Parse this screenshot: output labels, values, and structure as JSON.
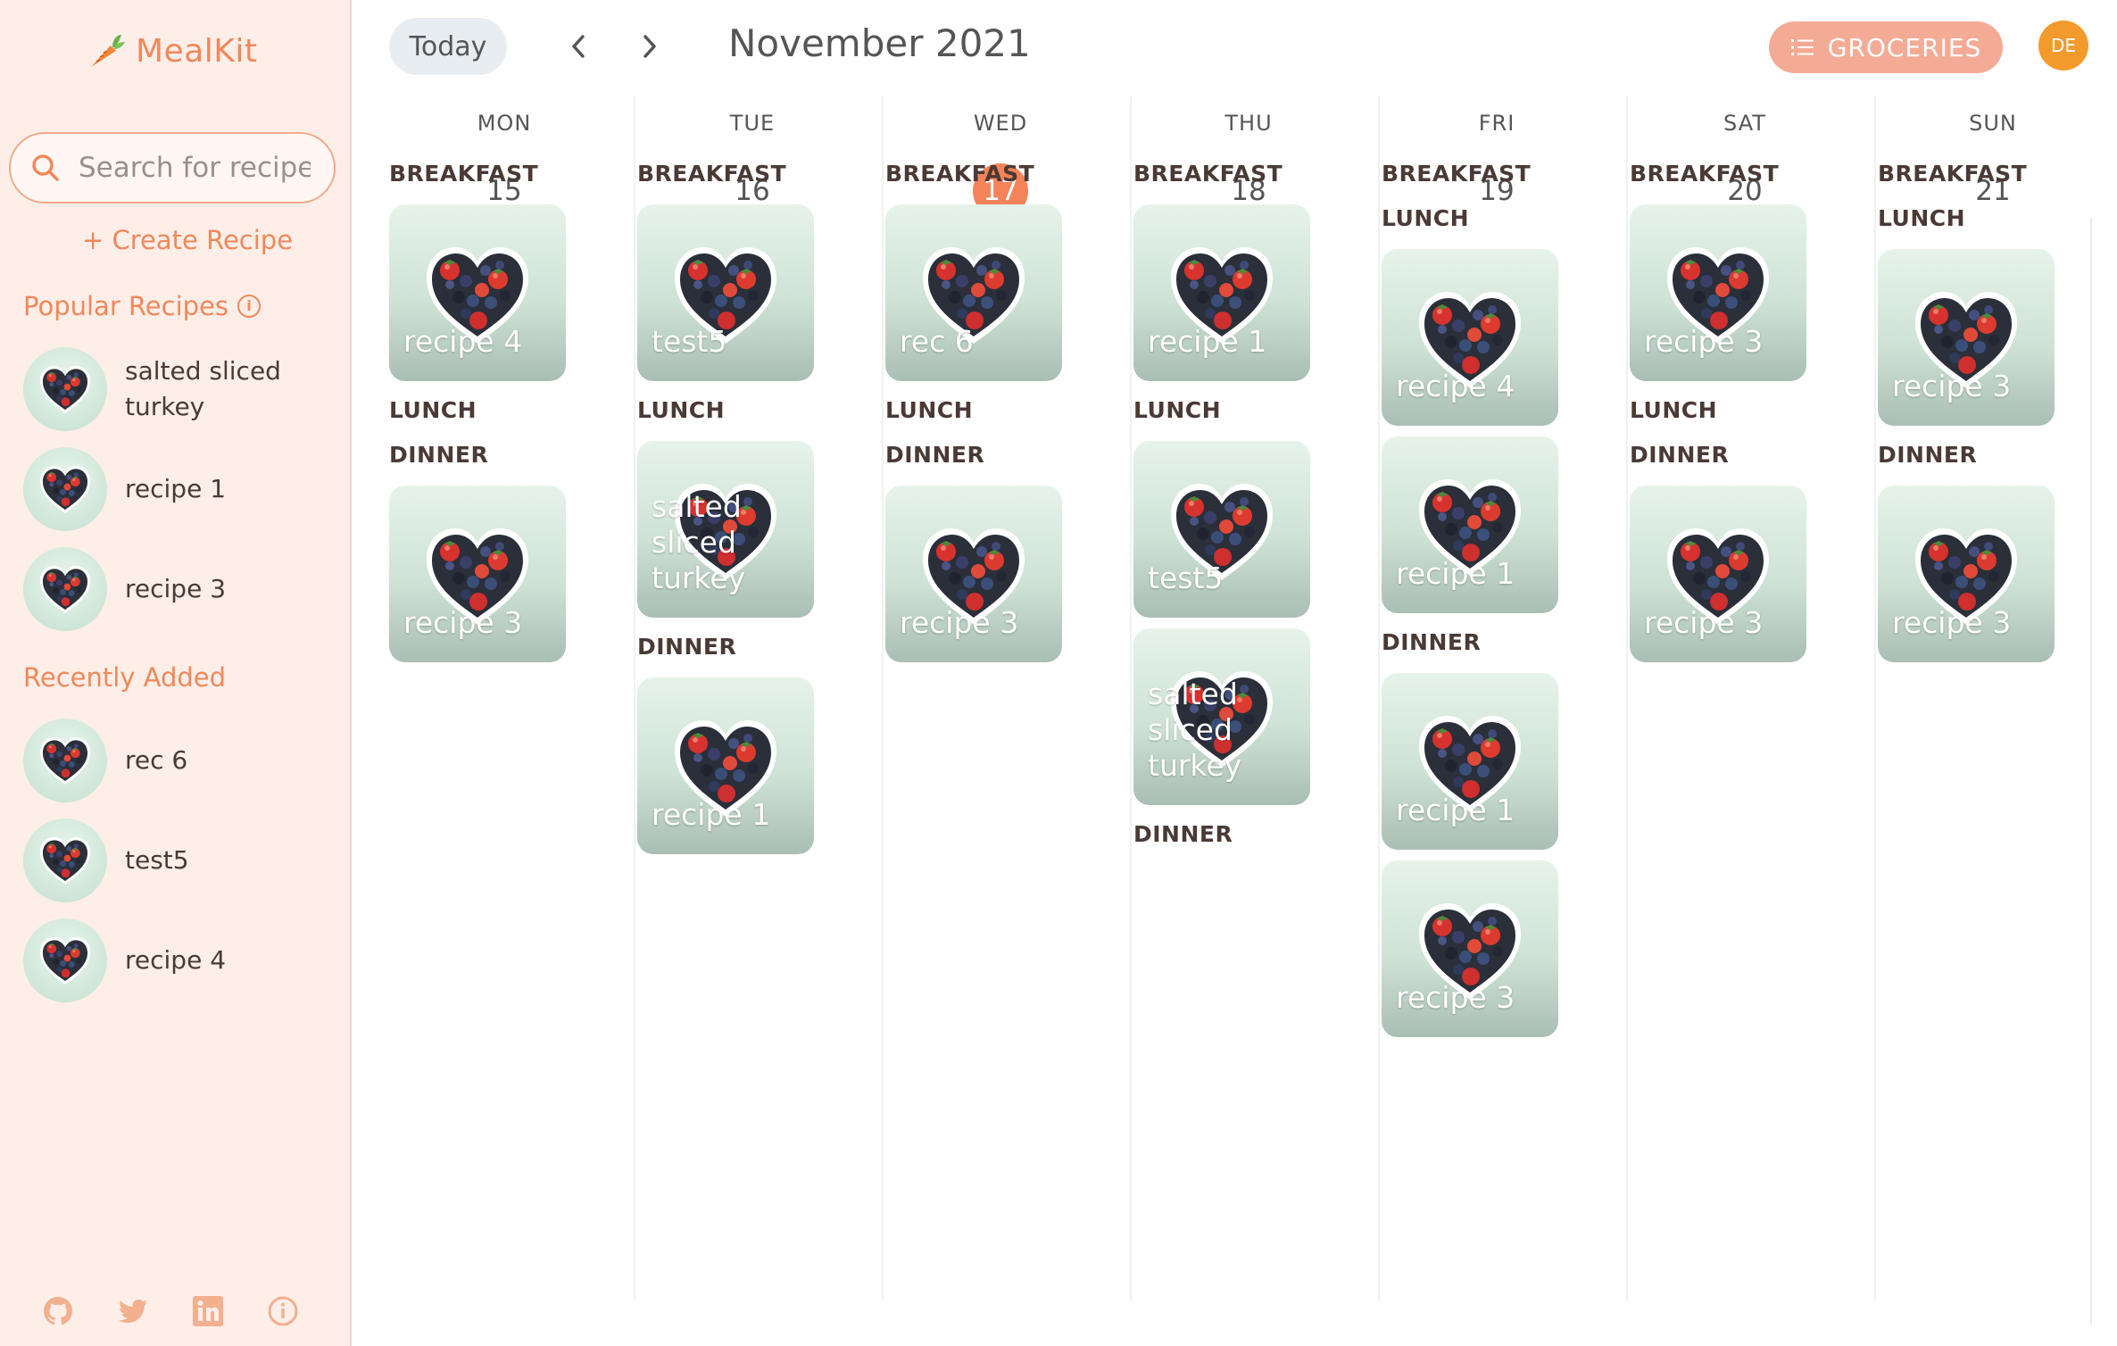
{
  "app": {
    "name": "MealKit"
  },
  "sidebar": {
    "search_placeholder": "Search for recipe",
    "create_label": "+ Create Recipe",
    "popular_title": "Popular Recipes",
    "popular": [
      {
        "label": "salted sliced turkey"
      },
      {
        "label": "recipe 1"
      },
      {
        "label": "recipe 3"
      }
    ],
    "recent_title": "Recently Added",
    "recent": [
      {
        "label": "rec 6"
      },
      {
        "label": "test5"
      },
      {
        "label": "recipe 4"
      }
    ],
    "socials": [
      "github-icon",
      "twitter-icon",
      "linkedin-icon",
      "info-icon"
    ]
  },
  "header": {
    "today_label": "Today",
    "month_title": "November 2021",
    "groceries_label": "GROCERIES",
    "avatar_initials": "DE"
  },
  "meal_names": {
    "breakfast": "BREAKFAST",
    "lunch": "LUNCH",
    "dinner": "DINNER"
  },
  "days": [
    {
      "name": "MON",
      "num": "15",
      "today": false,
      "breakfast": [
        "recipe 4"
      ],
      "lunch": [],
      "dinner": [
        "recipe 3"
      ]
    },
    {
      "name": "TUE",
      "num": "16",
      "today": false,
      "breakfast": [
        "test5"
      ],
      "lunch": [
        "salted sliced turkey"
      ],
      "dinner": [
        "recipe 1"
      ]
    },
    {
      "name": "WED",
      "num": "17",
      "today": true,
      "breakfast": [
        "rec 6"
      ],
      "lunch": [],
      "dinner": [
        "recipe 3"
      ]
    },
    {
      "name": "THU",
      "num": "18",
      "today": false,
      "breakfast": [
        "recipe 1"
      ],
      "lunch": [
        "test5",
        "salted sliced turkey"
      ],
      "dinner": []
    },
    {
      "name": "FRI",
      "num": "19",
      "today": false,
      "breakfast": [],
      "lunch": [
        "recipe 4",
        "recipe 1"
      ],
      "dinner": [
        "recipe 1",
        "recipe 3"
      ]
    },
    {
      "name": "SAT",
      "num": "20",
      "today": false,
      "breakfast": [
        "recipe 3"
      ],
      "lunch": [],
      "dinner": [
        "recipe 3"
      ]
    },
    {
      "name": "SUN",
      "num": "21",
      "today": false,
      "breakfast": [],
      "lunch": [
        "recipe 3"
      ],
      "dinner": [
        "recipe 3"
      ]
    }
  ],
  "colors": {
    "accent": "#f2885a",
    "today": "#f5835a",
    "groceries": "#f4ab95",
    "avatar": "#f39a2c",
    "sidebar_bg": "#fdeee8"
  }
}
